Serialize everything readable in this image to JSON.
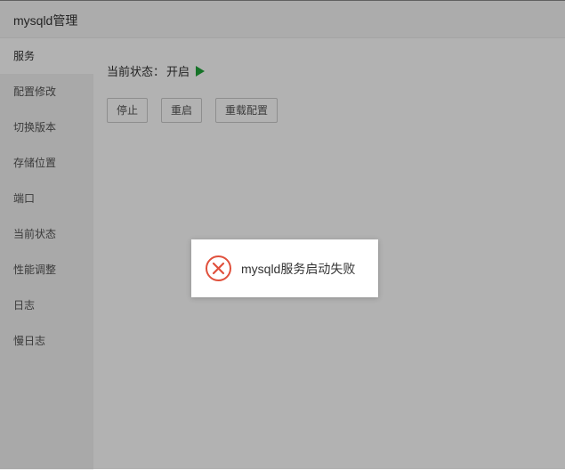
{
  "window": {
    "title": "mysqld管理"
  },
  "sidebar": {
    "items": [
      {
        "label": "服务"
      },
      {
        "label": "配置修改"
      },
      {
        "label": "切换版本"
      },
      {
        "label": "存储位置"
      },
      {
        "label": "端口"
      },
      {
        "label": "当前状态"
      },
      {
        "label": "性能调整"
      },
      {
        "label": "日志"
      },
      {
        "label": "慢日志"
      }
    ]
  },
  "service": {
    "status_label": "当前状态：",
    "status_value": "开启",
    "status_icon": "play-icon",
    "buttons": {
      "stop": "停止",
      "restart": "重启",
      "reload": "重载配置"
    }
  },
  "toast": {
    "icon": "error-circle-icon",
    "message": "mysqld服务启动失败"
  },
  "colors": {
    "status_running": "#20a53a",
    "error": "#e0503c",
    "overlay": "rgba(0,0,0,0.3)"
  }
}
